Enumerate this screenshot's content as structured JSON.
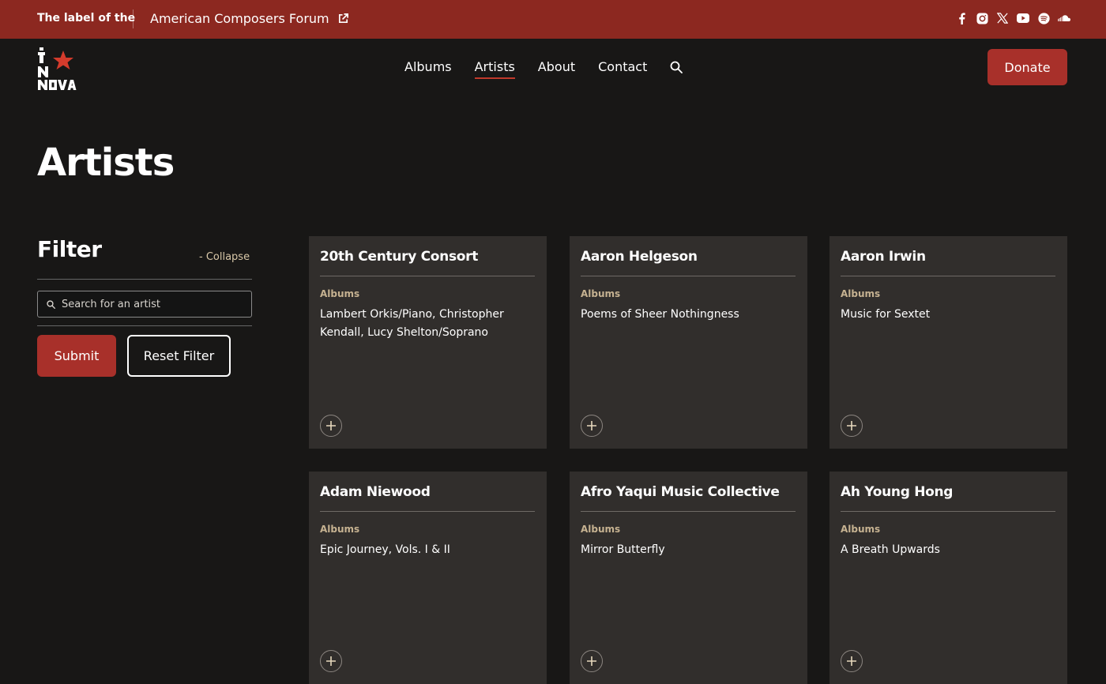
{
  "topbar": {
    "label_prefix": "The label of the",
    "link_text": "American Composers Forum",
    "social_icons": [
      "facebook-icon",
      "instagram-icon",
      "x-icon",
      "youtube-icon",
      "spotify-icon",
      "soundcloud-icon"
    ]
  },
  "nav": {
    "items": [
      {
        "label": "Albums",
        "active": false
      },
      {
        "label": "Artists",
        "active": true
      },
      {
        "label": "About",
        "active": false
      },
      {
        "label": "Contact",
        "active": false
      }
    ],
    "donate_label": "Donate",
    "logo_text": [
      "N",
      "NOVA"
    ]
  },
  "page": {
    "title": "Artists"
  },
  "filter": {
    "title": "Filter",
    "collapse_label": "- Collapse",
    "search_placeholder": "Search for an artist",
    "search_value": "",
    "submit_label": "Submit",
    "reset_label": "Reset Filter"
  },
  "colors": {
    "brand_red": "#8c2820",
    "button_red": "#a8302a",
    "background": "#181716",
    "card": "#312e2c",
    "albums_label": "#c6b291"
  },
  "artists": [
    {
      "name": "20th Century Consort",
      "albums_label": "Albums",
      "albums": "Lambert Orkis/Piano, Christopher Kendall, Lucy Shelton/Soprano"
    },
    {
      "name": "Aaron Helgeson",
      "albums_label": "Albums",
      "albums": "Poems of Sheer Nothingness"
    },
    {
      "name": "Aaron Irwin",
      "albums_label": "Albums",
      "albums": "Music for Sextet"
    },
    {
      "name": "Adam Niewood",
      "albums_label": "Albums",
      "albums": "Epic Journey, Vols. I & II"
    },
    {
      "name": "Afro Yaqui Music Collective",
      "albums_label": "Albums",
      "albums": "Mirror Butterfly"
    },
    {
      "name": "Ah Young Hong",
      "albums_label": "Albums",
      "albums": "A Breath Upwards"
    }
  ]
}
